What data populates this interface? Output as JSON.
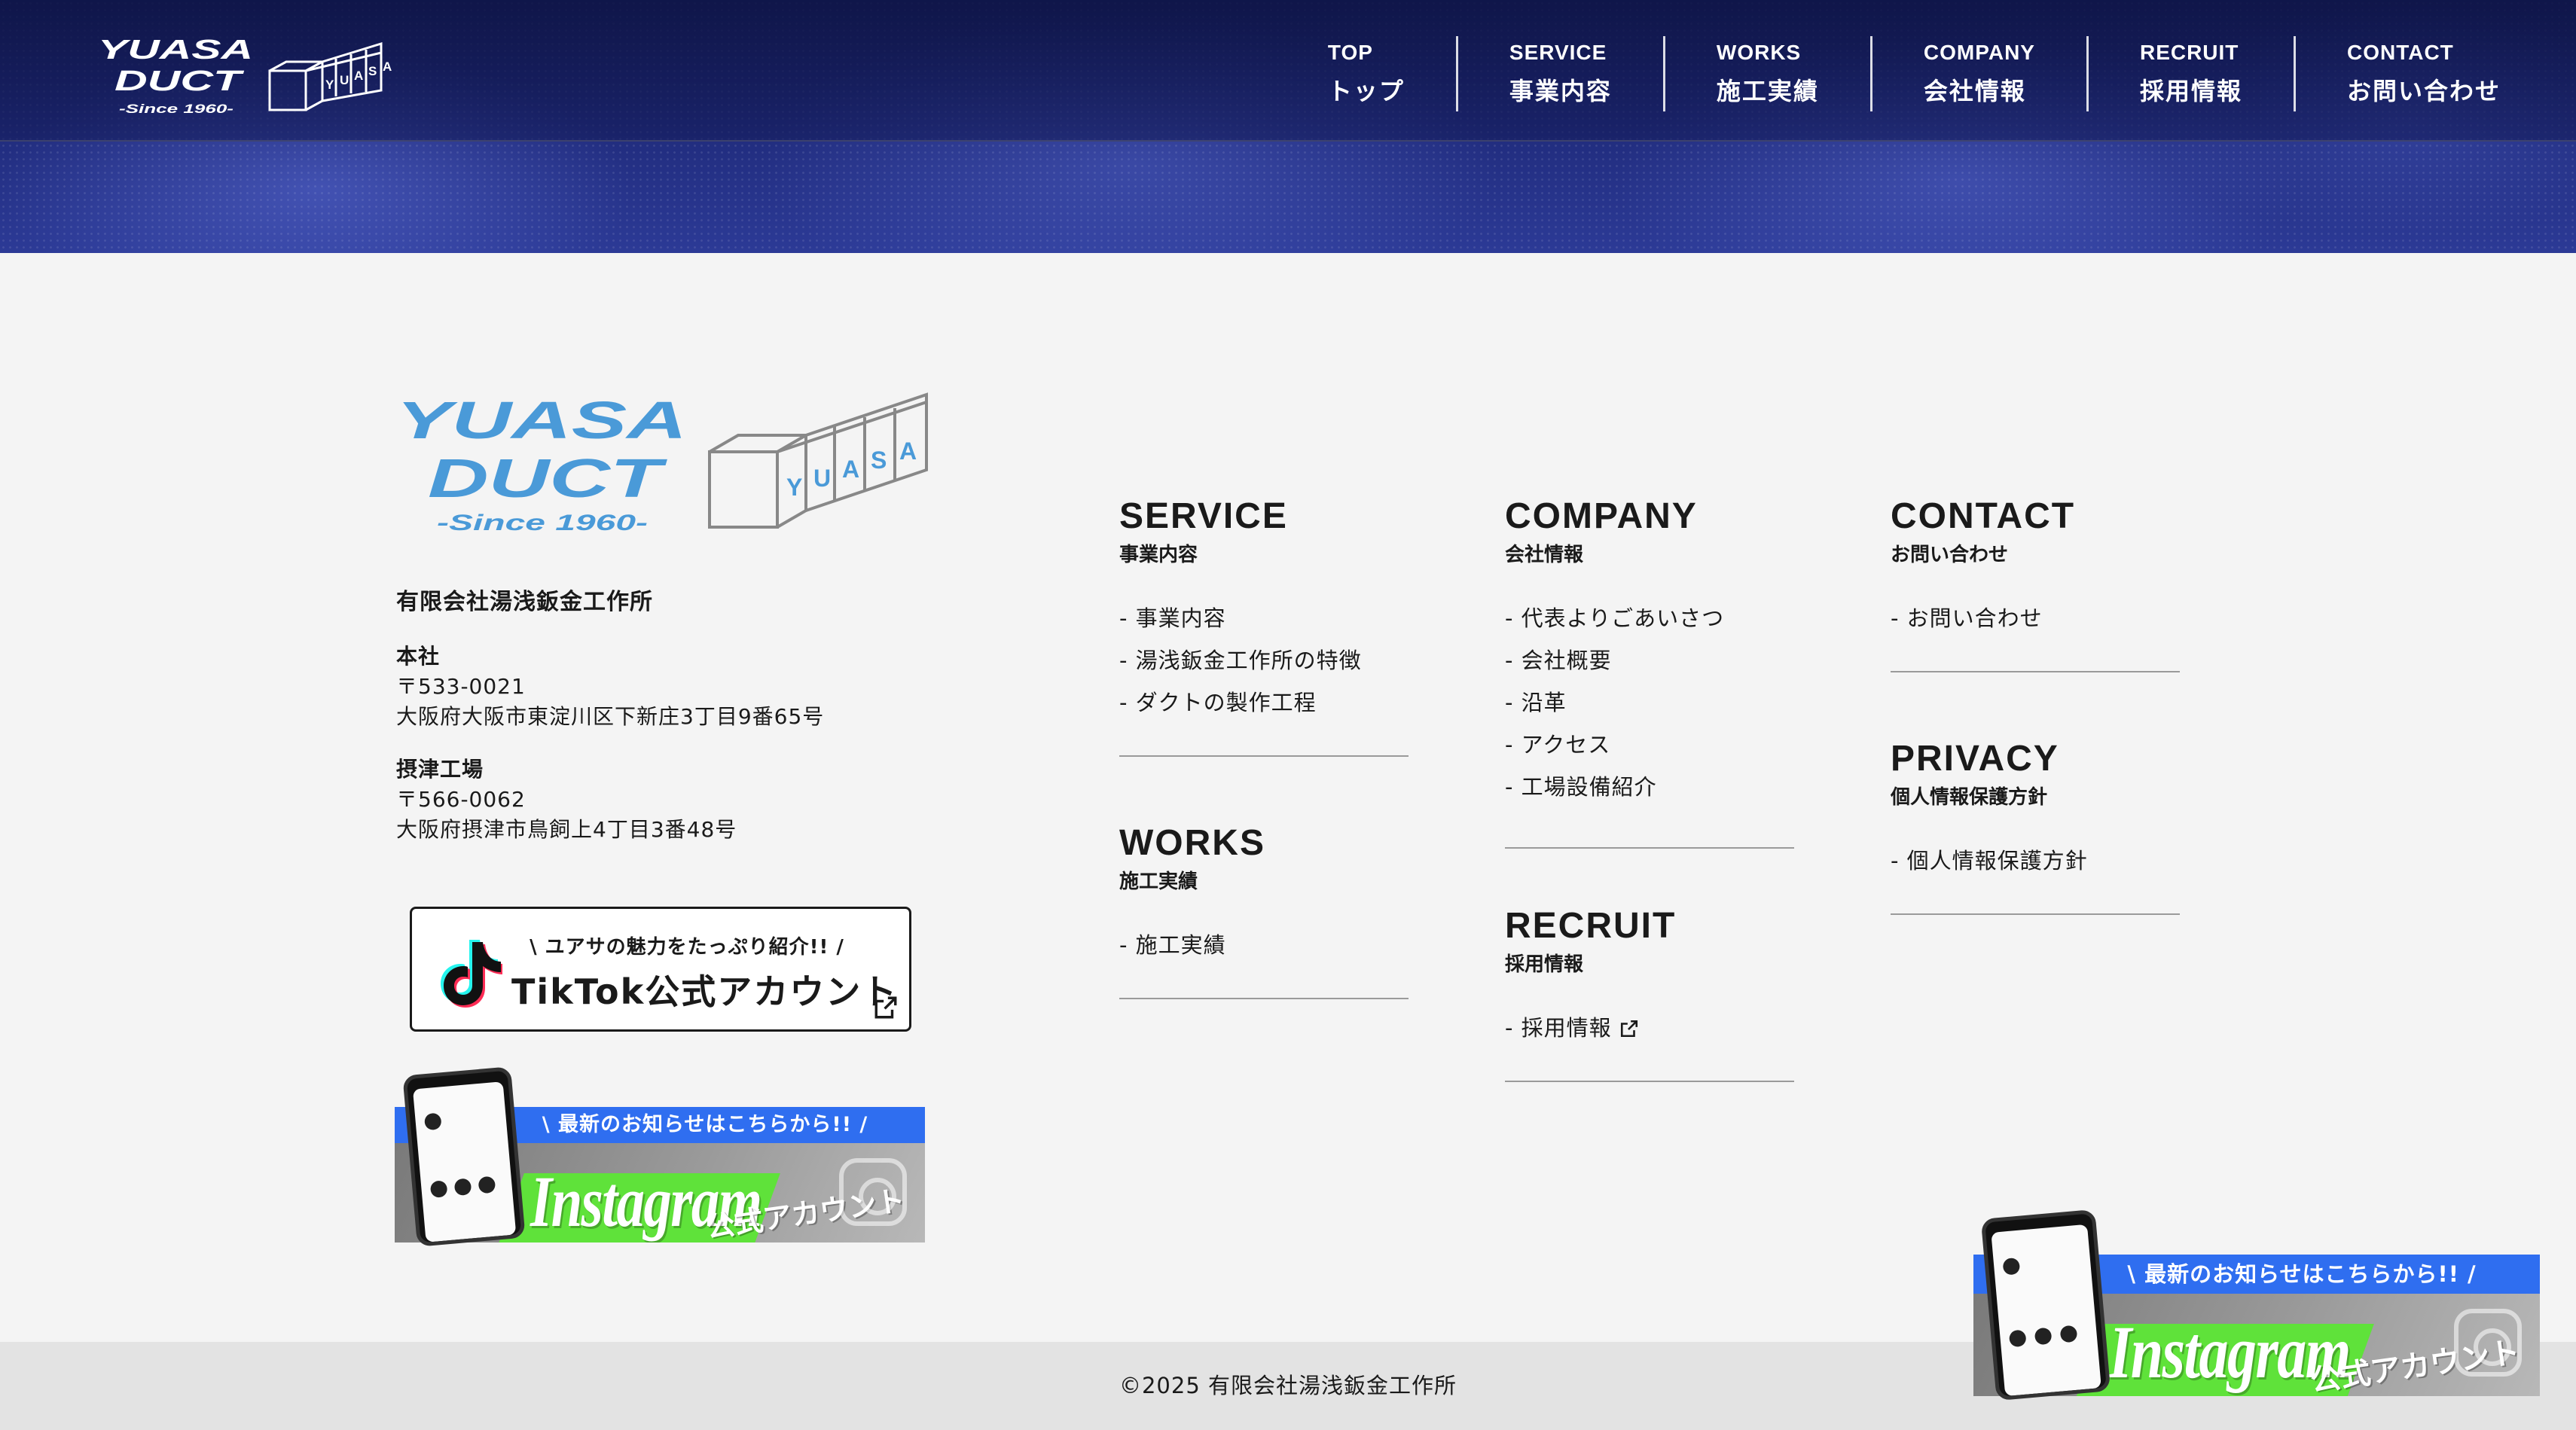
{
  "header": {
    "logo_line1": "YUASA",
    "logo_line2": "DUCT",
    "logo_since": "-Since 1960-",
    "nav": [
      {
        "en": "TOP",
        "ja": "トップ"
      },
      {
        "en": "SERVICE",
        "ja": "事業内容"
      },
      {
        "en": "WORKS",
        "ja": "施工実績"
      },
      {
        "en": "COMPANY",
        "ja": "会社情報"
      },
      {
        "en": "RECRUIT",
        "ja": "採用情報"
      },
      {
        "en": "CONTACT",
        "ja": "お問い合わせ"
      }
    ]
  },
  "footer": {
    "logo_line1": "YUASA",
    "logo_line2": "DUCT",
    "logo_since": "-Since 1960-",
    "duct_letters": [
      "Y",
      "U",
      "A",
      "S",
      "A"
    ],
    "company_name": "有限会社湯浅鈑金工作所",
    "offices": [
      {
        "title": "本社",
        "zip": "〒533-0021",
        "address": "大阪府大阪市東淀川区下新庄3丁目9番65号"
      },
      {
        "title": "摂津工場",
        "zip": "〒566-0062",
        "address": "大阪府摂津市鳥飼上4丁目3番48号"
      }
    ],
    "tiktok": {
      "sub": "\\ ユアサの魅力をたっぷり紹介!! /",
      "main": "TikTok公式アカウント"
    },
    "instagram": {
      "bar": "\\ 最新のお知らせはこちらから!! /",
      "word": "Instagram",
      "account": "公式アカウント"
    },
    "sections": {
      "service": {
        "title": "SERVICE",
        "sub": "事業内容",
        "links": [
          "- 事業内容",
          "- 湯浅鈑金工作所の特徴",
          "- ダクトの製作工程"
        ]
      },
      "works": {
        "title": "WORKS",
        "sub": "施工実績",
        "links": [
          "- 施工実績"
        ]
      },
      "company": {
        "title": "COMPANY",
        "sub": "会社情報",
        "links": [
          "- 代表よりごあいさつ",
          "- 会社概要",
          "- 沿革",
          "- アクセス",
          "- 工場設備紹介"
        ]
      },
      "recruit": {
        "title": "RECRUIT",
        "sub": "採用情報",
        "links": [
          "- 採用情報"
        ]
      },
      "contact": {
        "title": "CONTACT",
        "sub": "お問い合わせ",
        "links": [
          "- お問い合わせ"
        ]
      },
      "privacy": {
        "title": "PRIVACY",
        "sub": "個人情報保護方針",
        "links": [
          "- 個人情報保護方針"
        ]
      }
    },
    "copyright": "©2025 有限会社湯浅鈑金工作所"
  },
  "colors": {
    "header_bg": "#1f2a7a",
    "logo_blue": "#4a9ad8",
    "insta_bar": "#2f6ef0",
    "insta_green": "#5fe23a"
  }
}
